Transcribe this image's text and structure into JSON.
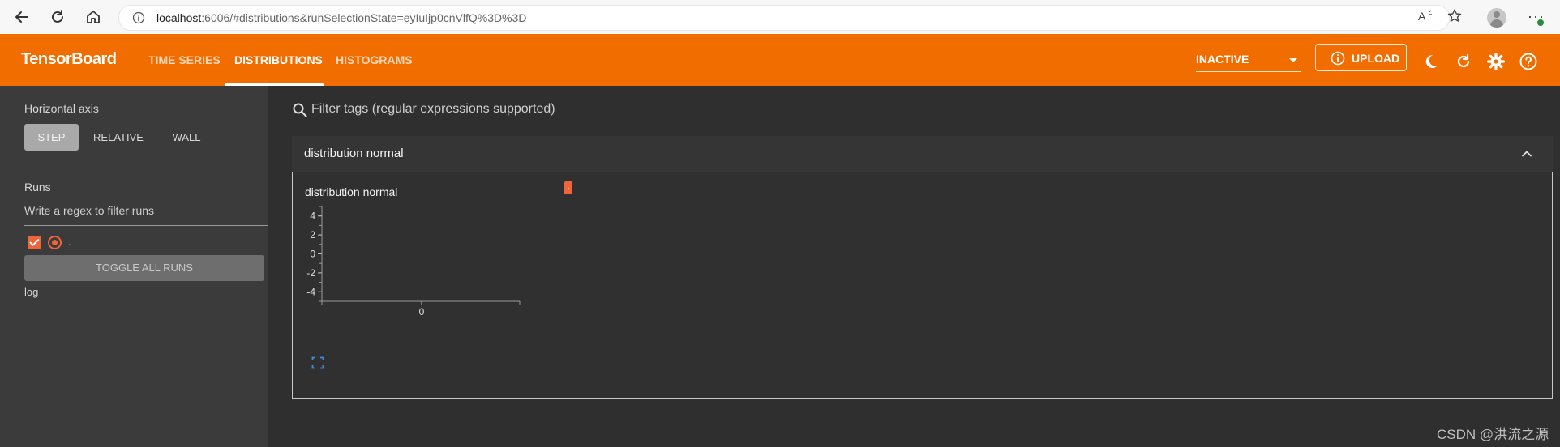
{
  "browser": {
    "url_host": "localhost",
    "url_rest": ":6006/#distributions&runSelectionState=eyIuIjp0cnVlfQ%3D%3D"
  },
  "app": {
    "brand": "TensorBoard",
    "tabs": [
      {
        "label": "TIME SERIES",
        "active": false
      },
      {
        "label": "DISTRIBUTIONS",
        "active": true
      },
      {
        "label": "HISTOGRAMS",
        "active": false
      }
    ],
    "run_state": "INACTIVE",
    "upload_label": "UPLOAD",
    "accent": "#f26d00",
    "run_color": "#f0643a"
  },
  "sidebar": {
    "horizontal_axis_label": "Horizontal axis",
    "axis_options": [
      {
        "label": "STEP",
        "active": true
      },
      {
        "label": "RELATIVE",
        "active": false
      },
      {
        "label": "WALL",
        "active": false
      }
    ],
    "runs_label": "Runs",
    "runs_filter_placeholder": "Write a regex to filter runs",
    "runs": [
      {
        "name": ".",
        "checked": true
      }
    ],
    "toggle_all_label": "TOGGLE ALL RUNS",
    "log_dir": "log"
  },
  "main": {
    "tag_filter_placeholder": "Filter tags (regular expressions supported)",
    "group_title": "distribution normal",
    "card": {
      "title": "distribution normal",
      "run_chip": "."
    }
  },
  "chart_data": {
    "type": "area",
    "title": "distribution normal",
    "xlabel": "",
    "ylabel": "",
    "x_ticks": [
      "0"
    ],
    "y_ticks": [
      "4",
      "2",
      "0",
      "-2",
      "-4"
    ],
    "ylim": [
      -5,
      5
    ],
    "series": []
  },
  "watermark": "CSDN @洪流之源"
}
